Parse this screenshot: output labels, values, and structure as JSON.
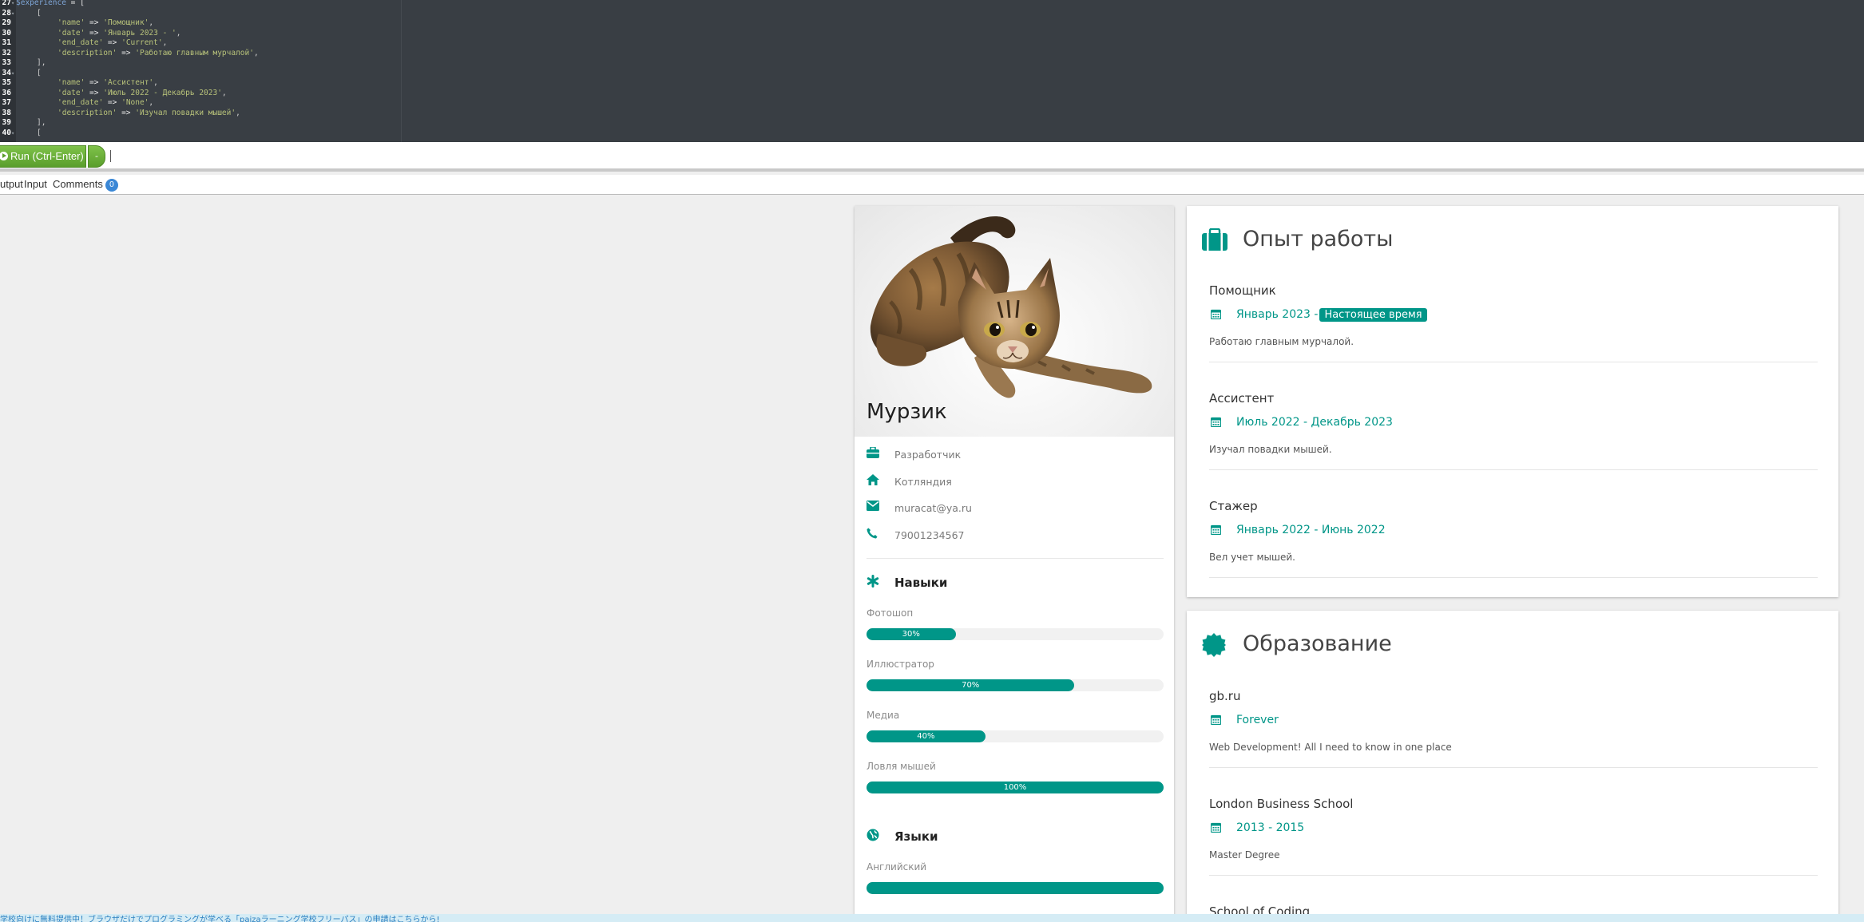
{
  "editor": {
    "lines": [
      {
        "num": "27",
        "fold": "▾",
        "indent": 0,
        "tokens": [
          {
            "t": "var",
            "v": "$experience"
          },
          {
            "t": "op",
            "v": " = ["
          }
        ]
      },
      {
        "num": "28",
        "fold": "▾",
        "indent": 1,
        "tokens": [
          {
            "t": "p",
            "v": "["
          }
        ]
      },
      {
        "num": "29",
        "fold": "",
        "indent": 2,
        "tokens": [
          {
            "t": "str",
            "v": "'name'"
          },
          {
            "t": "op",
            "v": " => "
          },
          {
            "t": "str",
            "v": "'Помощник'"
          },
          {
            "t": "p",
            "v": ","
          }
        ]
      },
      {
        "num": "30",
        "fold": "",
        "indent": 2,
        "tokens": [
          {
            "t": "str",
            "v": "'date'"
          },
          {
            "t": "op",
            "v": " => "
          },
          {
            "t": "str",
            "v": "'Январь 2023 - '"
          },
          {
            "t": "p",
            "v": ","
          }
        ]
      },
      {
        "num": "31",
        "fold": "",
        "indent": 2,
        "tokens": [
          {
            "t": "str",
            "v": "'end_date'"
          },
          {
            "t": "op",
            "v": " => "
          },
          {
            "t": "str",
            "v": "'Current'"
          },
          {
            "t": "p",
            "v": ","
          }
        ]
      },
      {
        "num": "32",
        "fold": "",
        "indent": 2,
        "tokens": [
          {
            "t": "str",
            "v": "'description'"
          },
          {
            "t": "op",
            "v": " => "
          },
          {
            "t": "str",
            "v": "'Работаю главным мурчалой'"
          },
          {
            "t": "p",
            "v": ","
          }
        ]
      },
      {
        "num": "33",
        "fold": "",
        "indent": 1,
        "tokens": [
          {
            "t": "p",
            "v": "],"
          }
        ]
      },
      {
        "num": "34",
        "fold": "▾",
        "indent": 1,
        "tokens": [
          {
            "t": "p",
            "v": "["
          }
        ]
      },
      {
        "num": "35",
        "fold": "",
        "indent": 2,
        "tokens": [
          {
            "t": "str",
            "v": "'name'"
          },
          {
            "t": "op",
            "v": " => "
          },
          {
            "t": "str",
            "v": "'Ассистент'"
          },
          {
            "t": "p",
            "v": ","
          }
        ]
      },
      {
        "num": "36",
        "fold": "",
        "indent": 2,
        "tokens": [
          {
            "t": "str",
            "v": "'date'"
          },
          {
            "t": "op",
            "v": " => "
          },
          {
            "t": "str",
            "v": "'Июль 2022 - Декабрь 2023'"
          },
          {
            "t": "p",
            "v": ","
          }
        ]
      },
      {
        "num": "37",
        "fold": "",
        "indent": 2,
        "tokens": [
          {
            "t": "str",
            "v": "'end_date'"
          },
          {
            "t": "op",
            "v": " => "
          },
          {
            "t": "str",
            "v": "'None'"
          },
          {
            "t": "p",
            "v": ","
          }
        ]
      },
      {
        "num": "38",
        "fold": "",
        "indent": 2,
        "tokens": [
          {
            "t": "str",
            "v": "'description'"
          },
          {
            "t": "op",
            "v": " => "
          },
          {
            "t": "str",
            "v": "'Изучал повадки мышей'"
          },
          {
            "t": "p",
            "v": ","
          }
        ]
      },
      {
        "num": "39",
        "fold": "",
        "indent": 1,
        "tokens": [
          {
            "t": "p",
            "v": "],"
          }
        ]
      },
      {
        "num": "40",
        "fold": "▾",
        "indent": 1,
        "tokens": [
          {
            "t": "p",
            "v": "["
          }
        ]
      }
    ]
  },
  "runbar": {
    "run_label": "Run (Ctrl-Enter)",
    "menu_label": "-"
  },
  "tabs": {
    "output": "utput",
    "input": "Input",
    "comments": "Comments",
    "comments_count": "0"
  },
  "profile": {
    "name": "Мурзик",
    "info": [
      {
        "icon": "briefcase-icon",
        "value": "Разработчик"
      },
      {
        "icon": "home-icon",
        "value": "Котляндия"
      },
      {
        "icon": "envelope-icon",
        "value": "muracat@ya.ru"
      },
      {
        "icon": "phone-icon",
        "value": "79001234567"
      }
    ],
    "skills_title": "Навыки",
    "skills": [
      {
        "name": "Фотошоп",
        "percent": 30,
        "label": "30%"
      },
      {
        "name": "Иллюстратор",
        "percent": 70,
        "label": "70%"
      },
      {
        "name": "Медиа",
        "percent": 40,
        "label": "40%"
      },
      {
        "name": "Ловля мышей",
        "percent": 100,
        "label": "100%"
      }
    ],
    "languages_title": "Языки",
    "languages": [
      {
        "name": "Английский",
        "percent": 100,
        "label": ""
      }
    ]
  },
  "experience": {
    "title": "Опыт работы",
    "entries": [
      {
        "name": "Помощник",
        "date": "Январь 2023 -",
        "current_badge": "Настоящее время",
        "description": "Работаю главным мурчалой."
      },
      {
        "name": "Ассистент",
        "date": "Июль 2022 - Декабрь 2023",
        "current_badge": "",
        "description": "Изучал повадки мышей."
      },
      {
        "name": "Стажер",
        "date": "Январь 2022 - Июнь 2022",
        "current_badge": "",
        "description": "Вел учет мышей."
      }
    ]
  },
  "education": {
    "title": "Образование",
    "entries": [
      {
        "name": "gb.ru",
        "date": "Forever",
        "description": "Web Development! All I need to know in one place"
      },
      {
        "name": "London Business School",
        "date": "2013 - 2015",
        "description": "Master Degree"
      },
      {
        "name": "School of Coding",
        "date": "",
        "description": ""
      }
    ]
  },
  "banner": {
    "text": "学校向けに無料提供中！ブラウザだけでプログラミングが学べる「paizaラーニング学校フリーパス」の申請はこちらから!"
  },
  "colors": {
    "accent": "#009688",
    "editor_bg": "#393e44",
    "run_green": "#6aad3a",
    "badge_blue": "#3a87d6"
  }
}
